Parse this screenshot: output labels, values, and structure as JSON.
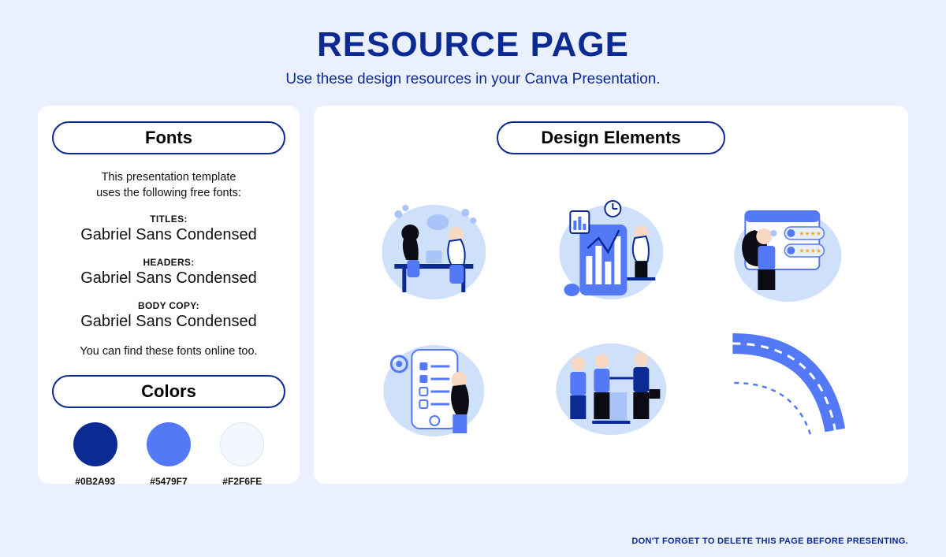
{
  "title": "RESOURCE PAGE",
  "subtitle": "Use these design resources in your Canva Presentation.",
  "fonts": {
    "header": "Fonts",
    "intro_line1": "This presentation template",
    "intro_line2": "uses the following free fonts:",
    "titles_label": "TITLES:",
    "titles_font": "Gabriel Sans Condensed",
    "headers_label": "HEADERS:",
    "headers_font": "Gabriel Sans Condensed",
    "body_label": "BODY COPY:",
    "body_font": "Gabriel Sans Condensed",
    "outro": "You can find these fonts online too."
  },
  "colors": {
    "header": "Colors",
    "swatches": [
      {
        "hex": "#0B2A93",
        "label": "#0B2A93"
      },
      {
        "hex": "#5479F7",
        "label": "#5479F7"
      },
      {
        "hex": "#F2F6FE",
        "label": "#F2F6FE"
      }
    ]
  },
  "design": {
    "header": "Design Elements"
  },
  "footer": "DON'T FORGET TO DELETE THIS PAGE BEFORE PRESENTING."
}
